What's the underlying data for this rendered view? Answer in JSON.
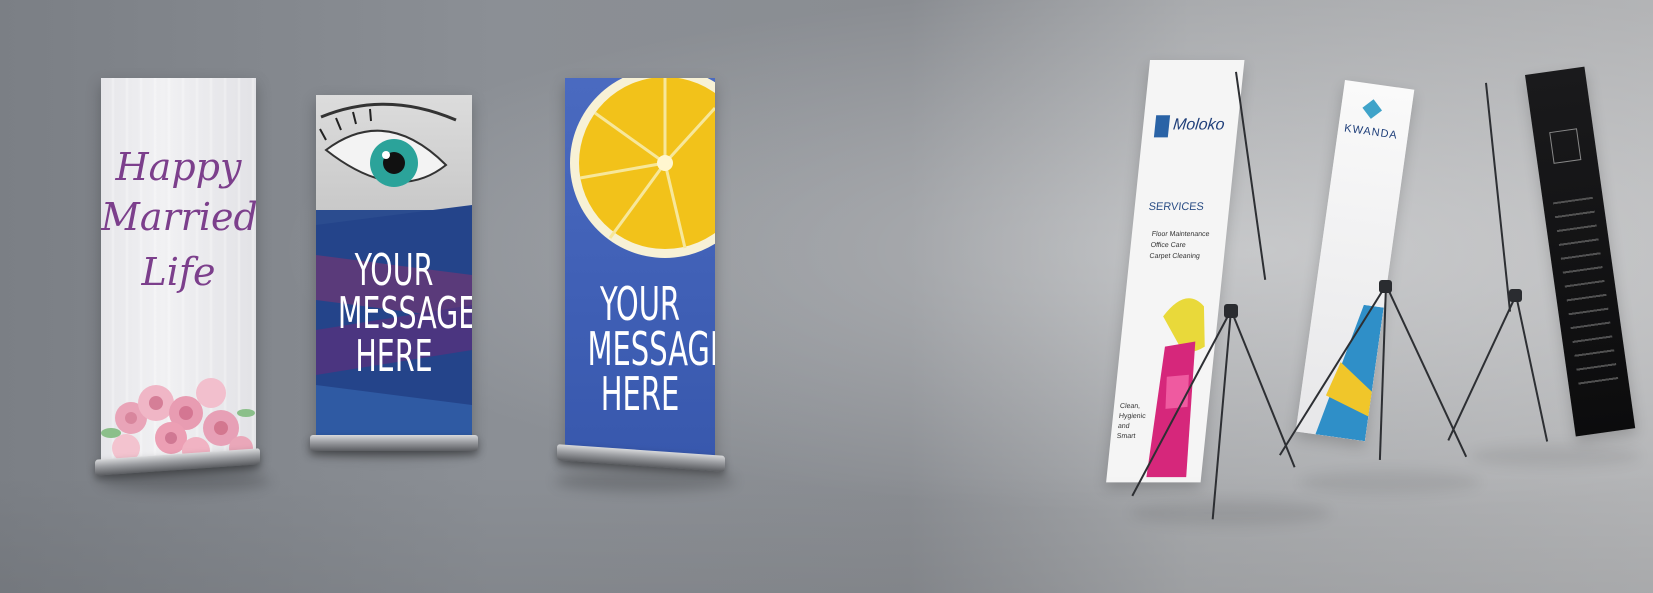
{
  "banners": {
    "wedding": {
      "line1": "Happy",
      "line2": "Married",
      "line3": "Life"
    },
    "eye": {
      "line1": "YOUR",
      "line2": "MESSAGE",
      "line3": "HERE"
    },
    "lemon": {
      "line1": "YOUR",
      "line2": "MESSAGE",
      "line3": "HERE"
    },
    "moloko": {
      "logo": "Moloko",
      "services": "SERVICES",
      "bullets": [
        "Floor Maintenance",
        "Office Care",
        "Carpet Cleaning"
      ],
      "tagline": "Clean, Hygienic and Smart"
    },
    "kwanda": {
      "logo": "KWANDA"
    }
  },
  "colors": {
    "background": "#8a8d92",
    "wedding_text": "#7c3f8c",
    "eye_panel": "#2b4c8f",
    "lemon_panel": "#3f5fb5",
    "lemon_yellow": "#f2c21a"
  }
}
